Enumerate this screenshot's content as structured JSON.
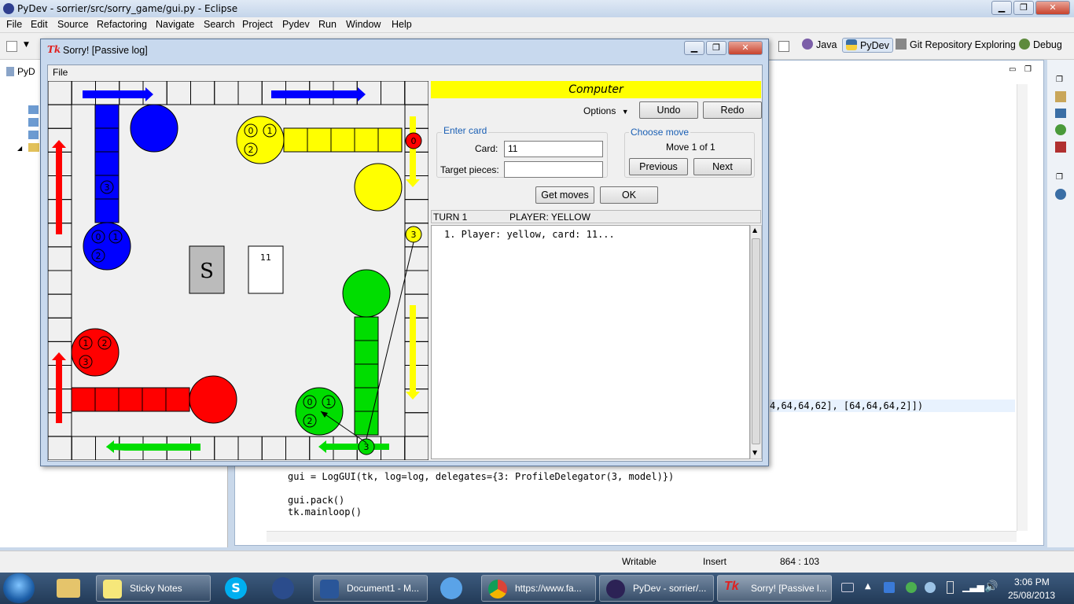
{
  "eclipse": {
    "title": "PyDev - sorrier/src/sorry_game/gui.py - Eclipse",
    "menu": [
      "File",
      "Edit",
      "Source",
      "Refactoring",
      "Navigate",
      "Search",
      "Project",
      "Pydev",
      "Run",
      "Window",
      "Help"
    ],
    "perspectives": [
      "Java",
      "PyDev",
      "Git Repository Exploring",
      "Debug"
    ],
    "left_tab": "PyD",
    "code": {
      "line_a": "4,64,64,62], [64,64,64,2]])",
      "line_b": "gui = LogGUI(tk, log=log, delegates={3: ProfileDelegator(3, model)})",
      "line_c": "gui.pack()",
      "line_d": "tk.mainloop()"
    },
    "status": {
      "mode": "Writable",
      "insert": "Insert",
      "position": "864 : 103"
    }
  },
  "taskbar": {
    "items": [
      "Sticky Notes",
      "Document1 - M...",
      "https://www.fa...",
      "PyDev - sorrier/...",
      "Sorry! [Passive l..."
    ],
    "time": "3:06 PM",
    "date": "25/08/2013"
  },
  "tk": {
    "title": "Sorry! [Passive log]",
    "menu_file": "File",
    "player_banner": "Computer",
    "options": "Options",
    "undo": "Undo",
    "redo": "Redo",
    "enter_card": "Enter card",
    "card_label": "Card:",
    "card_value": "11",
    "target_label": "Target pieces:",
    "target_value": "",
    "choose_move": "Choose move",
    "move_text": "Move 1 of 1",
    "previous": "Previous",
    "next": "Next",
    "get_moves": "Get moves",
    "ok": "OK",
    "turn": "TURN 1",
    "player": "PLAYER: YELLOW",
    "log_entry": "1. Player: yellow, card: 11...",
    "card_shown": "11",
    "deck_symbol": "S",
    "colors": {
      "yellow": "#ffff00",
      "blue": "#0000ff",
      "red": "#ff0000",
      "green": "#00dd00"
    },
    "pieces": {
      "yellow_start": [
        "0",
        "1",
        "2"
      ],
      "yellow_active": "3",
      "red_home": "0",
      "blue_start": [
        "0",
        "1",
        "2"
      ],
      "blue_safety": "3",
      "red_start": [
        "1",
        "2",
        "3"
      ],
      "green_start": [
        "0",
        "1",
        "2"
      ],
      "green_active": "3"
    }
  }
}
